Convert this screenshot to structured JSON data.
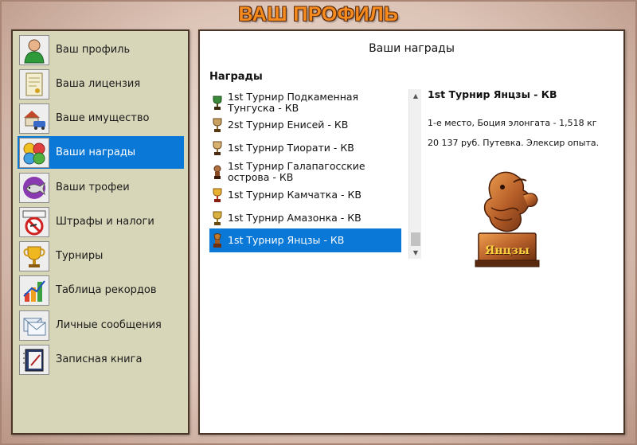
{
  "title": "ВАШ ПРОФИЛЬ",
  "sidebar": {
    "items": [
      {
        "label": "Ваш профиль",
        "icon": "user-icon"
      },
      {
        "label": "Ваша лицензия",
        "icon": "license-icon"
      },
      {
        "label": "Ваше имущество",
        "icon": "property-icon"
      },
      {
        "label": "Ваши награды",
        "icon": "awards-icon"
      },
      {
        "label": "Ваши трофеи",
        "icon": "fish-trophy-icon"
      },
      {
        "label": "Штрафы и налоги",
        "icon": "fines-icon"
      },
      {
        "label": "Турниры",
        "icon": "tournament-cup-icon"
      },
      {
        "label": "Таблица рекордов",
        "icon": "records-chart-icon"
      },
      {
        "label": "Личные сообщения",
        "icon": "messages-icon"
      },
      {
        "label": "Записная книга",
        "icon": "notebook-icon"
      }
    ],
    "selected": "Ваши награды",
    "accent": "#0a78d7"
  },
  "main": {
    "heading": "Ваши награды",
    "list_label": "Награды",
    "awards": [
      {
        "label": "1st Турнир Подкаменная Тунгуска - КВ",
        "icon": "trophy-icon"
      },
      {
        "label": "2st Турнир Енисей - КВ",
        "icon": "trophy-icon"
      },
      {
        "label": "1st Турнир Тиорати - КВ",
        "icon": "trophy-icon"
      },
      {
        "label": "1st Турнир Галапагосские острова - КВ",
        "icon": "trophy-icon"
      },
      {
        "label": "1st Турнир Камчатка - КВ",
        "icon": "trophy-icon"
      },
      {
        "label": "1st Турнир Амазонка - КВ",
        "icon": "trophy-icon"
      },
      {
        "label": "1st Турнир Янцзы - КВ",
        "icon": "trophy-icon"
      }
    ],
    "selected_award": "1st Турнир Янцзы - КВ",
    "detail": {
      "title": "1st Турнир Янцзы - КВ",
      "result": "1-е место, Боция элонгата - 1,518 кг",
      "prize": "20 137 руб. Путевка. Элексир опыта.",
      "trophy_label": "Янцзы",
      "trophy_icon": "dragon-statue-icon"
    }
  }
}
